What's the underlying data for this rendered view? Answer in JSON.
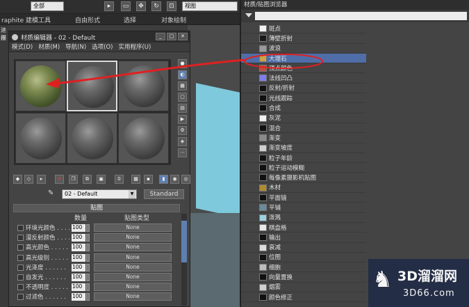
{
  "topbar": {
    "combo1": "全部",
    "combo2": "视图"
  },
  "ribbon": {
    "brand": "raphite 建模工具",
    "tabs": [
      "自由形式",
      "选择",
      "对象绘制"
    ]
  },
  "side_texts": [
    "建模",
    "形"
  ],
  "material_editor": {
    "title": "材质编辑器 - 02 - Default",
    "window_buttons": [
      "_",
      "□",
      "✕"
    ],
    "menu": [
      "模式(D)",
      "材质(M)",
      "导航(N)",
      "选项(O)",
      "实用程序(U)"
    ],
    "material_name": "02 - Default",
    "material_type": "Standard",
    "panel_title": "贴图",
    "col_amount": "数量",
    "col_maptype": "贴图类型",
    "maps": [
      {
        "label": "环境光颜色 . . . .",
        "amount": "100",
        "map": "None"
      },
      {
        "label": "漫反射颜色 . . . .",
        "amount": "100",
        "map": "None"
      },
      {
        "label": "高光颜色 . . . . .",
        "amount": "100",
        "map": "None"
      },
      {
        "label": "高光级别 . . . . .",
        "amount": "100",
        "map": "None"
      },
      {
        "label": "光泽度 . . . . . .",
        "amount": "100",
        "map": "None"
      },
      {
        "label": "自发光 . . . . . .",
        "amount": "100",
        "map": "None"
      },
      {
        "label": "不透明度 . . . . .",
        "amount": "100",
        "map": "None"
      },
      {
        "label": "过滤色 . . . . . .",
        "amount": "100",
        "map": "None"
      }
    ]
  },
  "browser": {
    "title": "材质/贴图浏览器",
    "items": [
      {
        "label": "斑点",
        "color": "#f2f2f2"
      },
      {
        "label": "薄壁折射",
        "color": "#1a1a1a"
      },
      {
        "label": "波浪",
        "color": "#9a9a9a"
      },
      {
        "label": "大理石",
        "color": "#c9a24a"
      },
      {
        "label": "顶点颜色",
        "color": "#c04a3a"
      },
      {
        "label": "法线凹凸",
        "color": "#7e7ef0"
      },
      {
        "label": "反射/折射",
        "color": "#111111"
      },
      {
        "label": "光线跟踪",
        "color": "#111111"
      },
      {
        "label": "合成",
        "color": "#111111"
      },
      {
        "label": "灰泥",
        "color": "#f0f0f0"
      },
      {
        "label": "混合",
        "color": "#111111"
      },
      {
        "label": "渐变",
        "color": "#8a8a8a"
      },
      {
        "label": "渐变坡度",
        "color": "#cfcfcf"
      },
      {
        "label": "粒子年龄",
        "color": "#111111"
      },
      {
        "label": "粒子运动模糊",
        "color": "#111111"
      },
      {
        "label": "每像素摄影机贴图",
        "color": "#111111"
      },
      {
        "label": "木材",
        "color": "#b08a30"
      },
      {
        "label": "平面镜",
        "color": "#111111"
      },
      {
        "label": "平铺",
        "color": "#6a8a9a"
      },
      {
        "label": "泼溅",
        "color": "#9ad0e0"
      },
      {
        "label": "棋盘格",
        "color": "#e8e8e8"
      },
      {
        "label": "输出",
        "color": "#111111"
      },
      {
        "label": "衰减",
        "color": "#dcdcdc"
      },
      {
        "label": "位图",
        "color": "#111111"
      },
      {
        "label": "细胞",
        "color": "#bdbdbd"
      },
      {
        "label": "向量置换",
        "color": "#111111"
      },
      {
        "label": "烟雾",
        "color": "#cfcfcf"
      },
      {
        "label": "颜色修正",
        "color": "#111111"
      }
    ]
  },
  "watermark": {
    "main": "3D溜溜网",
    "sub": "3D66.com"
  },
  "colors": {
    "selection": "#4f6ea8",
    "annotation": "#e02020"
  }
}
